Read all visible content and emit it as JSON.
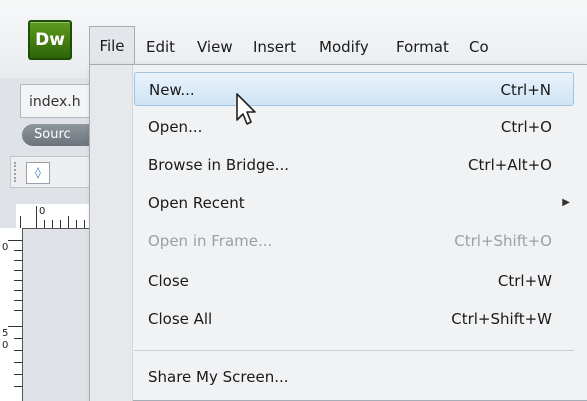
{
  "app": {
    "logo_text": "Dw",
    "brand_color": "#3f7d12"
  },
  "menubar": {
    "items": [
      "File",
      "Edit",
      "View",
      "Insert",
      "Modify",
      "Format",
      "Co"
    ]
  },
  "document": {
    "tab_label": "index.h",
    "source_label": "Sourc",
    "ruler_h_label": "0",
    "ruler_v_labels": [
      "0",
      "5",
      "0"
    ]
  },
  "file_menu": {
    "items": [
      {
        "label": "New...",
        "shortcut": "Ctrl+N",
        "highlighted": true
      },
      {
        "label": "Open...",
        "shortcut": "Ctrl+O"
      },
      {
        "label": "Browse in Bridge...",
        "shortcut": "Ctrl+Alt+O"
      },
      {
        "label": "Open Recent",
        "submenu": true
      },
      {
        "label": "Open in Frame...",
        "shortcut": "Ctrl+Shift+O",
        "disabled": true
      },
      {
        "label": "Close",
        "shortcut": "Ctrl+W"
      },
      {
        "label": "Close All",
        "shortcut": "Ctrl+Shift+W"
      },
      {
        "label": "Share My Screen..."
      }
    ]
  },
  "icons": {
    "submenu": "submenu-arrow-icon",
    "cursor": "mouse-cursor-icon",
    "code": "code-view-icon"
  }
}
